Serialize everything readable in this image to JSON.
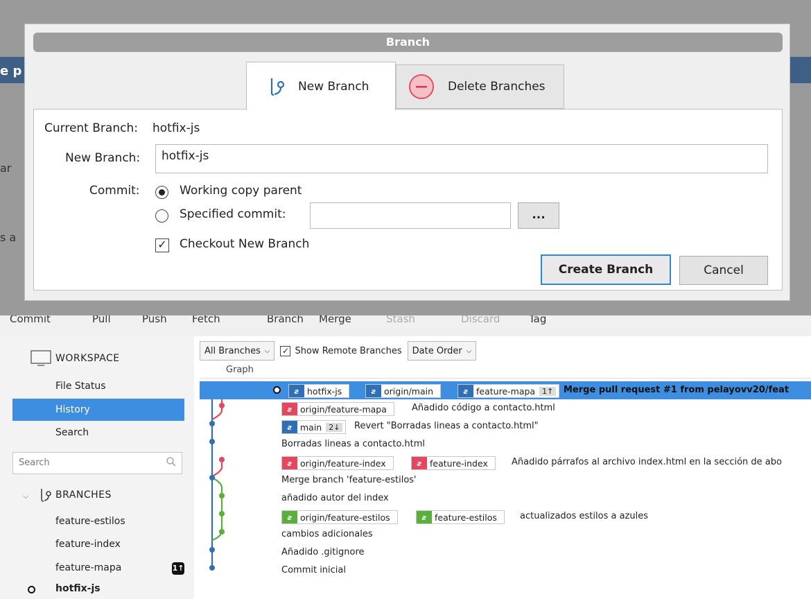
{
  "dialog": {
    "title": "Branch",
    "tabs": [
      {
        "label": "New Branch"
      },
      {
        "label": "Delete Branches"
      }
    ],
    "current_branch_label": "Current Branch:",
    "current_branch_value": "hotfix-js",
    "new_branch_label": "New Branch:",
    "new_branch_value": "hotfix-js",
    "commit_label": "Commit:",
    "radio_working": "Working copy parent",
    "radio_specified": "Specified commit:",
    "specified_commit_value": "",
    "browse_label": "...",
    "checkout_label": "Checkout New Branch",
    "checkout_checked": true,
    "create_button": "Create Branch",
    "cancel_button": "Cancel"
  },
  "background_fragments": {
    "strip_text": "e p",
    "ghost1": "ar",
    "ghost2": "s a"
  },
  "toolbar": [
    "Commit",
    "Pull",
    "Push",
    "Fetch",
    "Branch",
    "Merge",
    "Stash",
    "Discard",
    "Tag"
  ],
  "sidebar": {
    "workspace": "WORKSPACE",
    "items": [
      "File Status",
      "History",
      "Search"
    ],
    "search_placeholder": "Search",
    "branches_header": "BRANCHES",
    "branches": [
      {
        "name": "feature-estilos",
        "badge": ""
      },
      {
        "name": "feature-index",
        "badge": ""
      },
      {
        "name": "feature-mapa",
        "badge": "1↑"
      },
      {
        "name": "hotfix-js",
        "badge": ""
      }
    ]
  },
  "filters": {
    "all_branches": "All Branches",
    "show_remote": "Show Remote Branches",
    "date_order": "Date Order"
  },
  "graph_header": "Graph",
  "colors": {
    "accent": "#3d8ee0",
    "blue_branch": "#2f6fb5",
    "red_branch": "#e4475d",
    "green_branch": "#5aae3a"
  },
  "commits": [
    {
      "tags": [
        "hotfix-js",
        "origin/main",
        "feature-mapa"
      ],
      "ahead": "1↑",
      "message": "Merge pull request #1 from pelayovv20/feat"
    },
    {
      "tags": [
        "origin/feature-mapa"
      ],
      "message": "Añadido código a contacto.html"
    },
    {
      "tags": [
        "main"
      ],
      "ahead": "2↓",
      "message": "Revert \"Borradas lineas a contacto.html\""
    },
    {
      "tags": [],
      "message": "Borradas lineas a contacto.html"
    },
    {
      "tags": [
        "origin/feature-index",
        "feature-index"
      ],
      "message": "Añadido párrafos al archivo index.html en la sección de abo"
    },
    {
      "tags": [],
      "message": "Merge branch 'feature-estilos'"
    },
    {
      "tags": [],
      "message": "añadido autor del index"
    },
    {
      "tags": [
        "origin/feature-estilos",
        "feature-estilos"
      ],
      "message": "actualizados estilos a azules"
    },
    {
      "tags": [],
      "message": "cambios adicionales"
    },
    {
      "tags": [],
      "message": "Añadido .gitignore"
    },
    {
      "tags": [],
      "message": "Commit inicial"
    }
  ]
}
